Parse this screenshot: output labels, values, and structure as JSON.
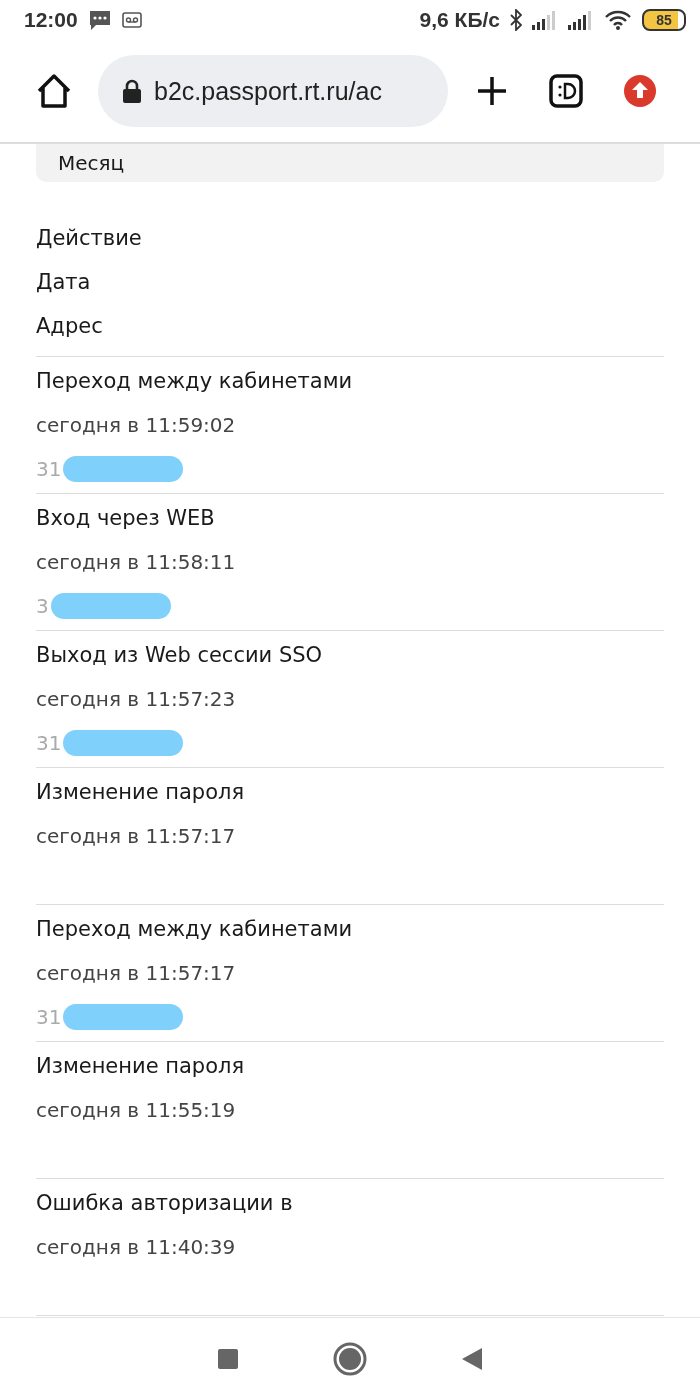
{
  "status_bar": {
    "time": "12:00",
    "speed": "9,6 КБ/с",
    "battery": "85"
  },
  "browser": {
    "url": "b2c.passport.rt.ru/ac"
  },
  "filter": {
    "value": "Месяц"
  },
  "headers": [
    "Действие",
    "Дата",
    "Адрес"
  ],
  "entries": [
    {
      "title": "Переход между кабинетами",
      "time": "сегодня в 11:59:02",
      "address": "31"
    },
    {
      "title": "Вход через WEB",
      "time": "сегодня в 11:58:11",
      "address": "3"
    },
    {
      "title": "Выход из Web сессии SSO",
      "time": "сегодня в 11:57:23",
      "address": "31"
    },
    {
      "title": "Изменение пароля",
      "time": "сегодня в 11:57:17"
    },
    {
      "title": "Переход между кабинетами",
      "time": "сегодня в 11:57:17",
      "address": "31"
    },
    {
      "title": "Изменение пароля",
      "time": "сегодня в 11:55:19"
    },
    {
      "title": "Ошибка авторизации в",
      "time": "сегодня в 11:40:39"
    }
  ]
}
